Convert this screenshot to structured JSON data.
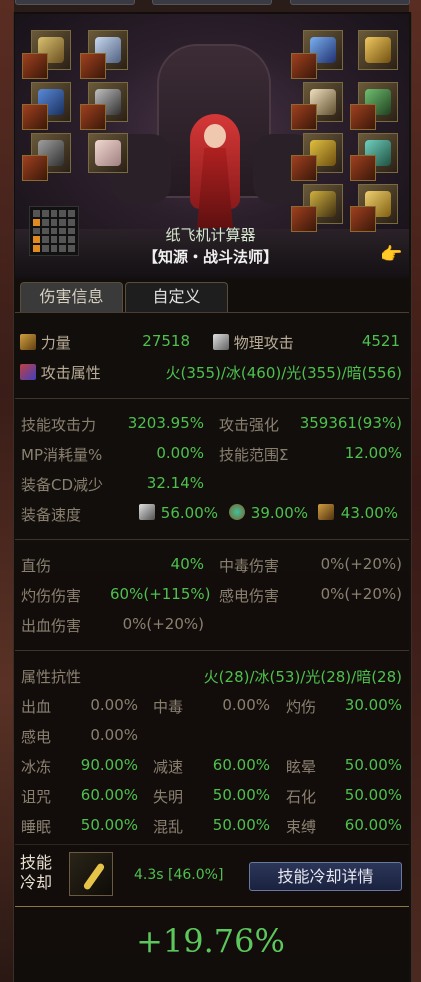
{
  "character": {
    "calculator_name": "纸飞机计算器",
    "class_name": "【知源・战斗法师】"
  },
  "tabs": [
    {
      "label": "伤害信息",
      "active": true
    },
    {
      "label": "自定义",
      "active": false
    }
  ],
  "basic": {
    "strength_label": "力量",
    "strength_value": "27518",
    "phys_atk_label": "物理攻击",
    "phys_atk_value": "4521",
    "attr_label": "攻击属性",
    "attr_value": "火(355)/冰(460)/光(355)/暗(556)"
  },
  "skill_stats": {
    "skill_atk_label": "技能攻击力",
    "skill_atk_value": "3203.95%",
    "atk_boost_label": "攻击强化",
    "atk_boost_value": "359361(93%)",
    "mp_label": "MP消耗量%",
    "mp_value": "0.00%",
    "range_label": "技能范围Σ",
    "range_value": "12.00%",
    "cd_label": "装备CD减少",
    "cd_value": "32.14%",
    "speed_label": "装备速度",
    "speed_atk": "56.00%",
    "speed_cast": "39.00%",
    "speed_move": "43.00%"
  },
  "damage": {
    "direct_label": "直伤",
    "direct_value": "40%",
    "poison_label": "中毒伤害",
    "poison_value": "0%(+20%)",
    "burn_label": "灼伤伤害",
    "burn_value": "60%(+115%)",
    "shock_label": "感电伤害",
    "shock_value": "0%(+20%)",
    "bleed_label": "出血伤害",
    "bleed_value": "0%(+20%)"
  },
  "resist": {
    "title": "属性抗性",
    "elements": "火(28)/冰(53)/光(28)/暗(28)",
    "rows": [
      [
        {
          "label": "出血",
          "value": "0.00%"
        },
        {
          "label": "中毒",
          "value": "0.00%"
        },
        {
          "label": "灼伤",
          "value": "30.00%"
        }
      ],
      [
        {
          "label": "感电",
          "value": "0.00%"
        }
      ],
      [
        {
          "label": "冰冻",
          "value": "90.00%"
        },
        {
          "label": "减速",
          "value": "60.00%"
        },
        {
          "label": "眩晕",
          "value": "50.00%"
        }
      ],
      [
        {
          "label": "诅咒",
          "value": "60.00%"
        },
        {
          "label": "失明",
          "value": "50.00%"
        },
        {
          "label": "石化",
          "value": "50.00%"
        }
      ],
      [
        {
          "label": "睡眠",
          "value": "50.00%"
        },
        {
          "label": "混乱",
          "value": "50.00%"
        },
        {
          "label": "束缚",
          "value": "60.00%"
        }
      ]
    ]
  },
  "cooldown": {
    "label_line1": "技能",
    "label_line2": "冷却",
    "value": "4.3s [46.0%]",
    "detail_button": "技能冷却详情",
    "total": "+19.76%"
  },
  "colors": {
    "accent_green": "#4ec04e",
    "dim_text": "#8a8070",
    "panel_bg": "#120e0c"
  }
}
